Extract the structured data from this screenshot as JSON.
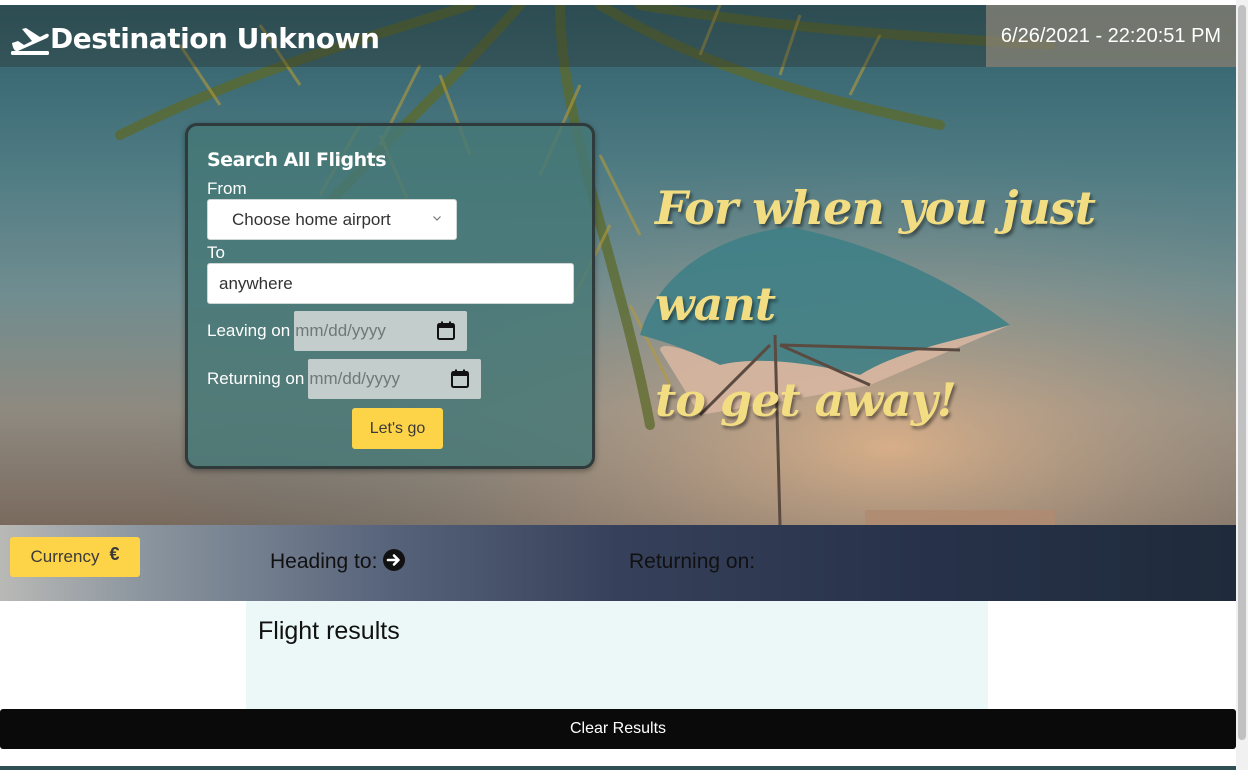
{
  "header": {
    "title": "Destination Unknown",
    "datetime": "6/26/2021 - 22:20:51 PM"
  },
  "search": {
    "title": "Search All Flights",
    "from_label": "From",
    "from_selected": "Choose home airport",
    "to_label": "To",
    "to_value": "anywhere",
    "leaving_label": "Leaving on",
    "leaving_placeholder": "mm/dd/yyyy",
    "returning_label": "Returning on",
    "returning_placeholder": "mm/dd/yyyy",
    "submit_label": "Let's go"
  },
  "tagline": {
    "line1": "For when you just want",
    "line2": "to get away!"
  },
  "info_bar": {
    "currency_label": "Currency",
    "currency_symbol": "€",
    "heading_to_label": "Heading to:",
    "returning_on_label": "Returning on:"
  },
  "results": {
    "title": "Flight results",
    "clear_label": "Clear Results"
  },
  "colors": {
    "accent_yellow": "#fdd348",
    "tagline_yellow": "#f2dd83",
    "panel_teal": "#46787a",
    "results_bg": "#ecf7f7"
  },
  "icons": {
    "logo": "airplane-departure-icon",
    "from_chevron": "chevron-down-icon",
    "date_picker": "calendar-icon",
    "heading_to": "arrow-circle-right-icon"
  }
}
